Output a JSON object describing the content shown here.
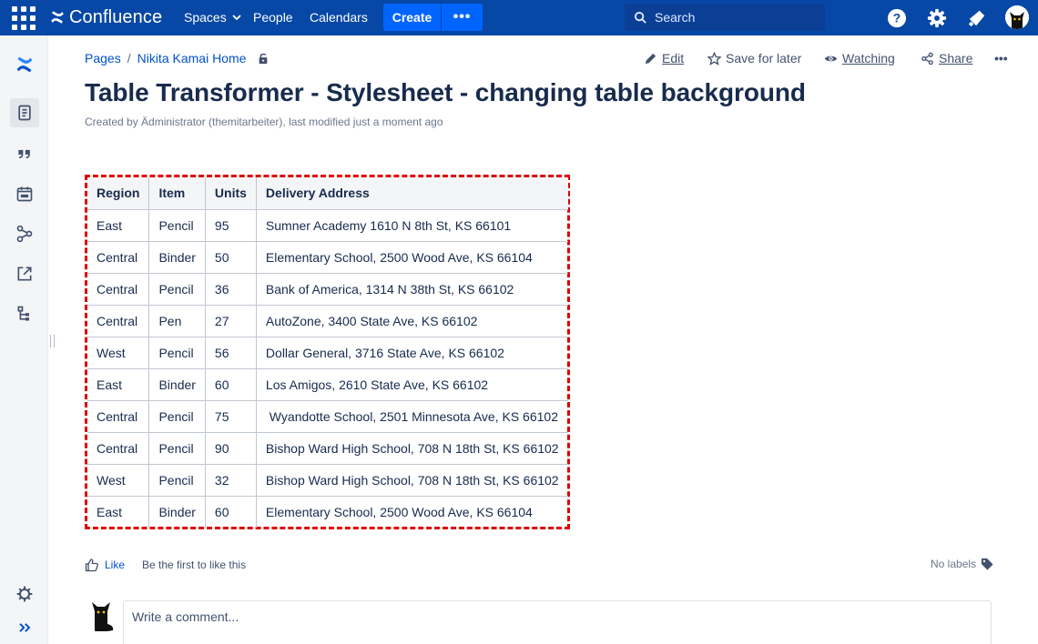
{
  "topnav": {
    "brand": "Confluence",
    "spaces": "Spaces",
    "people": "People",
    "calendars": "Calendars",
    "create": "Create",
    "more": "•••",
    "search_placeholder": "Search"
  },
  "breadcrumb": {
    "pages": "Pages",
    "separator": "/",
    "home": "Nikita Kamai Home"
  },
  "page_actions": {
    "edit": "Edit",
    "save_for_later": "Save for later",
    "watching": "Watching",
    "share": "Share",
    "more": "•••"
  },
  "page": {
    "title": "Table Transformer - Stylesheet - changing table background",
    "byline": "Created by Ädministrator (themitarbeiter), last modified just a moment ago"
  },
  "table": {
    "headers": [
      "Region",
      "Item",
      "Units",
      "Delivery Address"
    ],
    "rows": [
      [
        "East",
        "Pencil",
        "95",
        "Sumner Academy 1610 N 8th St, KS 66101"
      ],
      [
        "Central",
        "Binder",
        "50",
        "Elementary School, 2500 Wood Ave, KS 66104"
      ],
      [
        "Central",
        "Pencil",
        "36",
        "Bank of America, 1314 N 38th St, KS 66102"
      ],
      [
        "Central",
        "Pen",
        "27",
        "AutoZone, 3400 State Ave, KS 66102"
      ],
      [
        "West",
        "Pencil",
        "56",
        "Dollar General, 3716 State Ave, KS 66102"
      ],
      [
        "East",
        "Binder",
        "60",
        "Los Amigos, 2610 State Ave, KS 66102"
      ],
      [
        "Central",
        "Pencil",
        "75",
        " Wyandotte School, 2501 Minnesota Ave, KS 66102"
      ],
      [
        "Central",
        "Pencil",
        "90",
        "Bishop Ward High School, 708 N 18th St, KS 66102"
      ],
      [
        "West",
        "Pencil",
        "32",
        "Bishop Ward High School, 708 N 18th St, KS 66102"
      ],
      [
        "East",
        "Binder",
        "60",
        "Elementary School, 2500 Wood Ave, KS 66104"
      ]
    ]
  },
  "footer": {
    "like": "Like",
    "first_like": "Be the first to like this",
    "labels": "No labels",
    "comment_placeholder": "Write a comment..."
  },
  "colors": {
    "nav_bg": "#0747a6",
    "create_bg": "#0065ff",
    "link": "#0052cc",
    "table_border_highlight": "#e00000",
    "header_bg": "#f4f5f7"
  },
  "icons": {
    "app_switcher": "app-switcher-icon",
    "help": "help-icon",
    "settings": "gear-icon",
    "notifications": "megaphone-icon",
    "lock": "lock-icon"
  }
}
